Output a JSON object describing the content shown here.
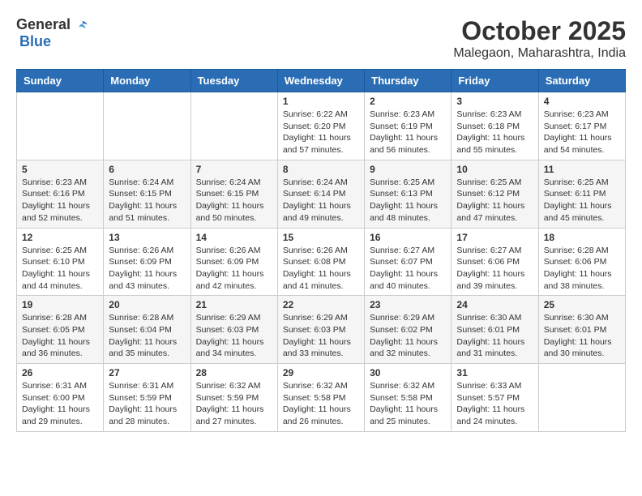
{
  "header": {
    "logo_general": "General",
    "logo_blue": "Blue",
    "month_title": "October 2025",
    "location": "Malegaon, Maharashtra, India"
  },
  "weekdays": [
    "Sunday",
    "Monday",
    "Tuesday",
    "Wednesday",
    "Thursday",
    "Friday",
    "Saturday"
  ],
  "weeks": [
    [
      {
        "day": "",
        "info": ""
      },
      {
        "day": "",
        "info": ""
      },
      {
        "day": "",
        "info": ""
      },
      {
        "day": "1",
        "sunrise": "6:22 AM",
        "sunset": "6:20 PM",
        "daylight": "11 hours and 57 minutes."
      },
      {
        "day": "2",
        "sunrise": "6:23 AM",
        "sunset": "6:19 PM",
        "daylight": "11 hours and 56 minutes."
      },
      {
        "day": "3",
        "sunrise": "6:23 AM",
        "sunset": "6:18 PM",
        "daylight": "11 hours and 55 minutes."
      },
      {
        "day": "4",
        "sunrise": "6:23 AM",
        "sunset": "6:17 PM",
        "daylight": "11 hours and 54 minutes."
      }
    ],
    [
      {
        "day": "5",
        "sunrise": "6:23 AM",
        "sunset": "6:16 PM",
        "daylight": "11 hours and 52 minutes."
      },
      {
        "day": "6",
        "sunrise": "6:24 AM",
        "sunset": "6:15 PM",
        "daylight": "11 hours and 51 minutes."
      },
      {
        "day": "7",
        "sunrise": "6:24 AM",
        "sunset": "6:15 PM",
        "daylight": "11 hours and 50 minutes."
      },
      {
        "day": "8",
        "sunrise": "6:24 AM",
        "sunset": "6:14 PM",
        "daylight": "11 hours and 49 minutes."
      },
      {
        "day": "9",
        "sunrise": "6:25 AM",
        "sunset": "6:13 PM",
        "daylight": "11 hours and 48 minutes."
      },
      {
        "day": "10",
        "sunrise": "6:25 AM",
        "sunset": "6:12 PM",
        "daylight": "11 hours and 47 minutes."
      },
      {
        "day": "11",
        "sunrise": "6:25 AM",
        "sunset": "6:11 PM",
        "daylight": "11 hours and 45 minutes."
      }
    ],
    [
      {
        "day": "12",
        "sunrise": "6:25 AM",
        "sunset": "6:10 PM",
        "daylight": "11 hours and 44 minutes."
      },
      {
        "day": "13",
        "sunrise": "6:26 AM",
        "sunset": "6:09 PM",
        "daylight": "11 hours and 43 minutes."
      },
      {
        "day": "14",
        "sunrise": "6:26 AM",
        "sunset": "6:09 PM",
        "daylight": "11 hours and 42 minutes."
      },
      {
        "day": "15",
        "sunrise": "6:26 AM",
        "sunset": "6:08 PM",
        "daylight": "11 hours and 41 minutes."
      },
      {
        "day": "16",
        "sunrise": "6:27 AM",
        "sunset": "6:07 PM",
        "daylight": "11 hours and 40 minutes."
      },
      {
        "day": "17",
        "sunrise": "6:27 AM",
        "sunset": "6:06 PM",
        "daylight": "11 hours and 39 minutes."
      },
      {
        "day": "18",
        "sunrise": "6:28 AM",
        "sunset": "6:06 PM",
        "daylight": "11 hours and 38 minutes."
      }
    ],
    [
      {
        "day": "19",
        "sunrise": "6:28 AM",
        "sunset": "6:05 PM",
        "daylight": "11 hours and 36 minutes."
      },
      {
        "day": "20",
        "sunrise": "6:28 AM",
        "sunset": "6:04 PM",
        "daylight": "11 hours and 35 minutes."
      },
      {
        "day": "21",
        "sunrise": "6:29 AM",
        "sunset": "6:03 PM",
        "daylight": "11 hours and 34 minutes."
      },
      {
        "day": "22",
        "sunrise": "6:29 AM",
        "sunset": "6:03 PM",
        "daylight": "11 hours and 33 minutes."
      },
      {
        "day": "23",
        "sunrise": "6:29 AM",
        "sunset": "6:02 PM",
        "daylight": "11 hours and 32 minutes."
      },
      {
        "day": "24",
        "sunrise": "6:30 AM",
        "sunset": "6:01 PM",
        "daylight": "11 hours and 31 minutes."
      },
      {
        "day": "25",
        "sunrise": "6:30 AM",
        "sunset": "6:01 PM",
        "daylight": "11 hours and 30 minutes."
      }
    ],
    [
      {
        "day": "26",
        "sunrise": "6:31 AM",
        "sunset": "6:00 PM",
        "daylight": "11 hours and 29 minutes."
      },
      {
        "day": "27",
        "sunrise": "6:31 AM",
        "sunset": "5:59 PM",
        "daylight": "11 hours and 28 minutes."
      },
      {
        "day": "28",
        "sunrise": "6:32 AM",
        "sunset": "5:59 PM",
        "daylight": "11 hours and 27 minutes."
      },
      {
        "day": "29",
        "sunrise": "6:32 AM",
        "sunset": "5:58 PM",
        "daylight": "11 hours and 26 minutes."
      },
      {
        "day": "30",
        "sunrise": "6:32 AM",
        "sunset": "5:58 PM",
        "daylight": "11 hours and 25 minutes."
      },
      {
        "day": "31",
        "sunrise": "6:33 AM",
        "sunset": "5:57 PM",
        "daylight": "11 hours and 24 minutes."
      },
      {
        "day": "",
        "info": ""
      }
    ]
  ],
  "labels": {
    "sunrise": "Sunrise:",
    "sunset": "Sunset:",
    "daylight": "Daylight:"
  }
}
